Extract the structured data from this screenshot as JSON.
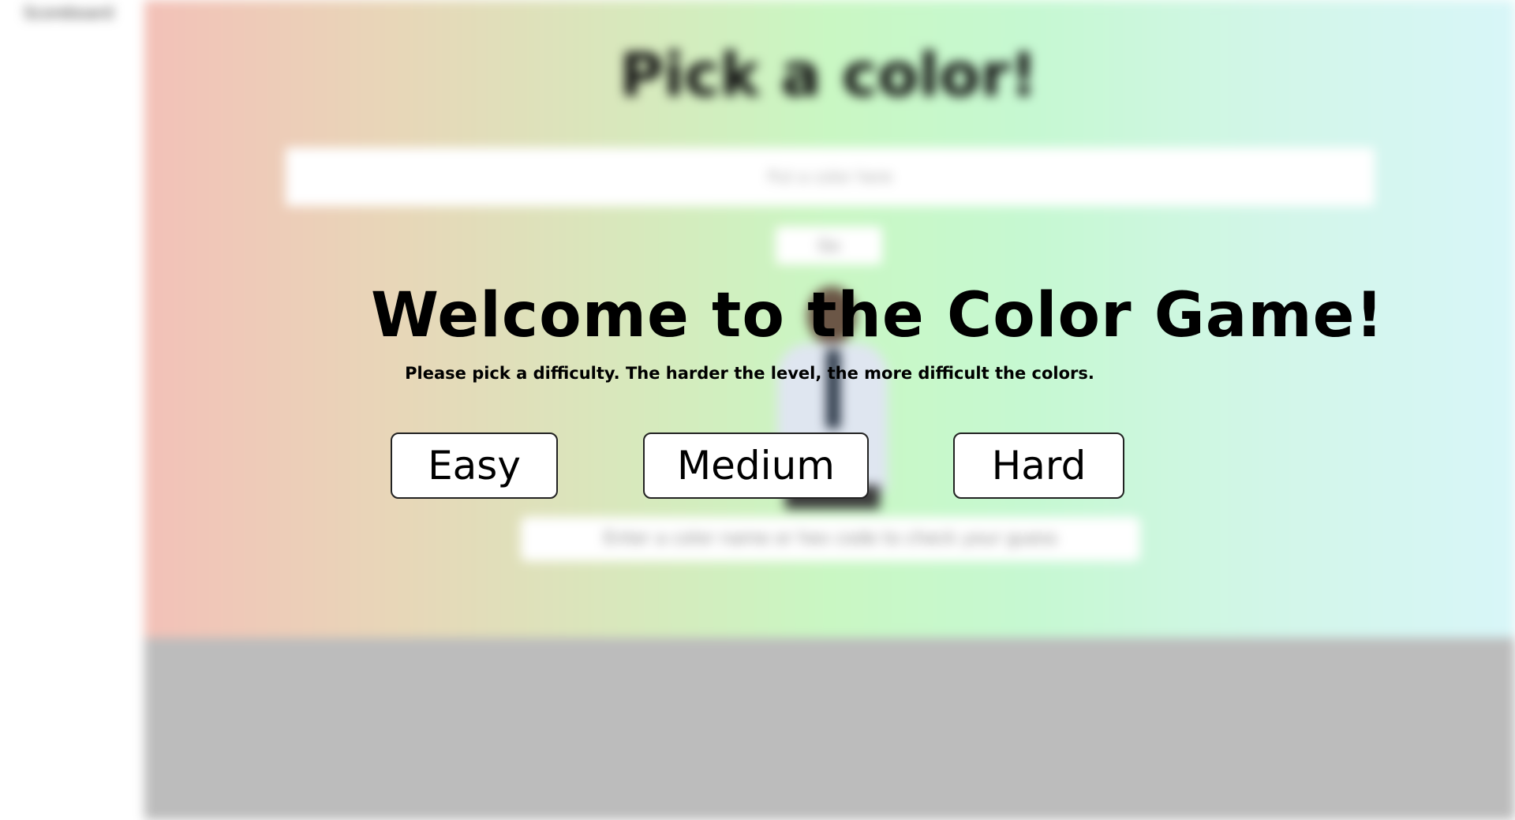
{
  "background": {
    "corner_text": "Scoreboard",
    "top_small_text": "",
    "title": "Pick a color!",
    "input_placeholder": "Put a color here",
    "button_label": "Go",
    "footer_note": "Enter a color name or hex code to check your guess",
    "colors": {
      "gradient_start": "#f3c1b8",
      "gradient_mid": "#c9f7c3",
      "gradient_end": "#d8f6f8",
      "lower_panel": "#bcbcbc"
    }
  },
  "welcome": {
    "title": "Welcome to the Color Game!",
    "subtitle": "Please pick a difficulty. The harder the level, the more difficult the colors.",
    "buttons": {
      "easy": "Easy",
      "medium": "Medium",
      "hard": "Hard"
    }
  }
}
